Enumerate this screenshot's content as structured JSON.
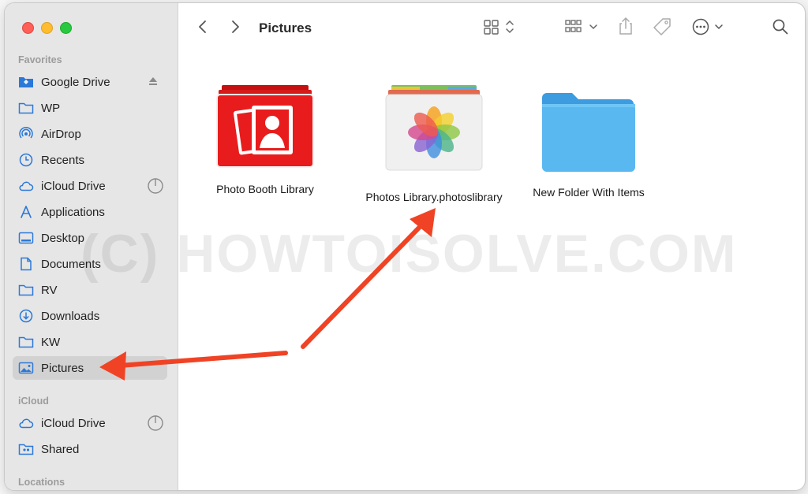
{
  "toolbar": {
    "title": "Pictures"
  },
  "sidebar": {
    "favorites_header": "Favorites",
    "icloud_header": "iCloud",
    "locations_header": "Locations",
    "favorites": [
      {
        "label": "Google Drive",
        "icon": "drive-folder-icon"
      },
      {
        "label": "WP",
        "icon": "folder-icon"
      },
      {
        "label": "AirDrop",
        "icon": "airdrop-icon"
      },
      {
        "label": "Recents",
        "icon": "clock-icon"
      },
      {
        "label": "iCloud Drive",
        "icon": "cloud-icon"
      },
      {
        "label": "Applications",
        "icon": "applications-icon"
      },
      {
        "label": "Desktop",
        "icon": "desktop-icon"
      },
      {
        "label": "Documents",
        "icon": "document-icon"
      },
      {
        "label": "RV",
        "icon": "folder-icon"
      },
      {
        "label": "Downloads",
        "icon": "download-icon"
      },
      {
        "label": "KW",
        "icon": "folder-icon"
      },
      {
        "label": "Pictures",
        "icon": "pictures-icon",
        "selected": true
      }
    ],
    "icloud": [
      {
        "label": "iCloud Drive",
        "icon": "cloud-icon"
      },
      {
        "label": "Shared",
        "icon": "shared-folder-icon"
      }
    ]
  },
  "files": [
    {
      "name": "Photo Booth Library",
      "icon": "photo-booth-library-icon"
    },
    {
      "name": "Photos Library.photoslibrary",
      "icon": "photos-library-icon"
    },
    {
      "name": "New Folder With Items",
      "icon": "folder-icon"
    }
  ],
  "watermark": "(C) HOWTOISOLVE.COM",
  "colors": {
    "accent": "#2b78d8",
    "arrow": "#f04325",
    "sidebar_bg": "#e6e6e6",
    "folder_blue": "#5ab8f0"
  }
}
